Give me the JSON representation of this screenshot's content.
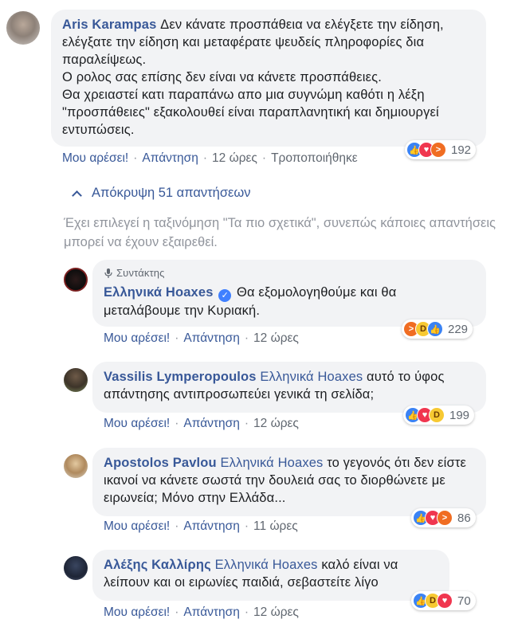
{
  "comment": {
    "author": "Aris Karampas",
    "text": "Δεν κάνατε προσπάθεια να ελέγξετε την είδηση, ελέγξατε την είδηση και μεταφέρατε ψευδείς πληροφορίες δια παραλείψεως.\nΟ ρολος σας επίσης δεν είναι να κάνετε προσπάθειες.\nΘα χρειαστεί κατι παραπάνω απο μια συγνώμη καθότι η λέξη \"προσπάθειες\" εξακολουθεί είναι παραπλανητική και δημιουργεί εντυπώσεις.",
    "like": "Μου αρέσει!",
    "reply": "Απάντηση",
    "time": "12 ώρες",
    "edited": "Τροποποιήθηκε",
    "reaction_count": "192"
  },
  "hide_replies": "Απόκρυψη 51 απαντήσεων",
  "sort_notice": "Έχει επιλεγεί η ταξινόμηση \"Τα πιο σχετικά\", συνεπώς κάποιες απαντήσεις μπορεί να έχουν εξαιρεθεί.",
  "replies": [
    {
      "badge": "Συντάκτης",
      "author": "Ελληνικά Hoaxes",
      "text": "Θα εξομολογηθούμε και θα μεταλάβουμε την Κυριακή.",
      "like": "Μου αρέσει!",
      "reply": "Απάντηση",
      "time": "12 ώρες",
      "reaction_count": "229"
    },
    {
      "author": "Vassilis Lymperopoulos",
      "tag": "Ελληνικά Hoaxes",
      "text": "αυτό το ύφος απάντησης αντιπροσωπεύει γενικά τη σελίδα;",
      "like": "Μου αρέσει!",
      "reply": "Απάντηση",
      "time": "12 ώρες",
      "reaction_count": "199"
    },
    {
      "author": "Apostolos Pavlou",
      "tag": "Ελληνικά Hoaxes",
      "text": "το γεγονός ότι δεν είστε ικανοί να κάνετε σωστά την δουλειά σας το διορθώνετε με ειρωνεία; Μόνο στην Ελλάδα...",
      "like": "Μου αρέσει!",
      "reply": "Απάντηση",
      "time": "11 ώρες",
      "reaction_count": "86"
    },
    {
      "author": "Αλέξης Καλλίρης",
      "tag": "Ελληνικά Hoaxes",
      "text": "καλό είναι να λείπουν και οι ειρωνίες παιδιά, σεβαστείτε λίγο",
      "like": "Μου αρέσει!",
      "reply": "Απάντηση",
      "time": "12 ώρες",
      "reaction_count": "70"
    }
  ],
  "colors": {
    "link": "#385898",
    "bubble": "#f2f3f5",
    "meta": "#606770",
    "like": "#3b83f4",
    "love": "#f0364f",
    "angry": "#f06d22",
    "haha": "#f7c932"
  }
}
